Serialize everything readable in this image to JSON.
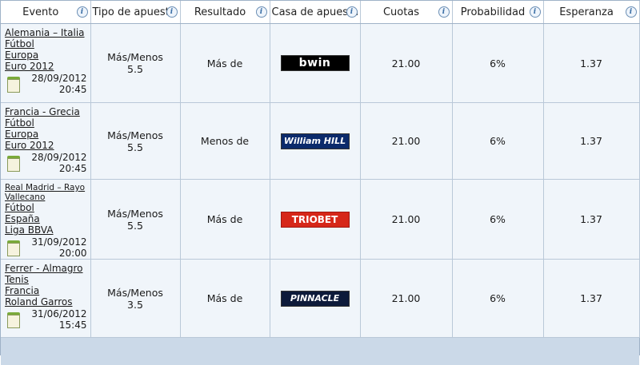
{
  "headers": {
    "evento": "Evento",
    "tipo": "Tipo de apuesta",
    "resultado": "Resultado",
    "casa": "Casa de apuesta",
    "cuotas": "Cuotas",
    "probabilidad": "Probabilidad",
    "esperanza": "Esperanza",
    "info_icon": "i"
  },
  "rows": [
    {
      "event_name": "Alemania – Italia",
      "sport": "Fútbol",
      "region": "Europa",
      "league": "Euro 2012",
      "date": "28/09/2012",
      "time": "20:45",
      "bet_type": "Más/Menos",
      "line": "5.5",
      "result": "Más de",
      "bookmaker": "bwin",
      "odds": "21.00",
      "probability": "6%",
      "expectation": "1.37"
    },
    {
      "event_name": "Francia - Grecia",
      "sport": "Fútbol",
      "region": "Europa",
      "league": "Euro 2012",
      "date": "28/09/2012",
      "time": "20:45",
      "bet_type": "Más/Menos",
      "line": "5.5",
      "result": "Menos de",
      "bookmaker": "William HILL",
      "odds": "21.00",
      "probability": "6%",
      "expectation": "1.37"
    },
    {
      "event_name": "Real Madrid – Rayo Vallecano",
      "sport": "Fútbol",
      "region": "España",
      "league": "Liga BBVA",
      "date": "31/09/2012",
      "time": "20:00",
      "bet_type": "Más/Menos",
      "line": "5.5",
      "result": "Más de",
      "bookmaker": "TRIOBET",
      "odds": "21.00",
      "probability": "6%",
      "expectation": "1.37"
    },
    {
      "event_name": "Ferrer - Almagro",
      "sport": "Tenis",
      "region": "Francia",
      "league": "Roland Garros",
      "date": "31/06/2012",
      "time": "15:45",
      "bet_type": "Más/Menos",
      "line": "3.5",
      "result": "Más de",
      "bookmaker": "PINNACLE",
      "odds": "21.00",
      "probability": "6%",
      "expectation": "1.37"
    }
  ],
  "icons": {
    "info": "info-icon",
    "calendar": "calendar-icon"
  },
  "colors": {
    "bwin": "#000000",
    "william_hill": "#0b2a6b",
    "triobet": "#d62718",
    "pinnacle": "#0d1a3a",
    "row_bg": "#f0f5fa",
    "footer_bg": "#cbd9e8"
  }
}
